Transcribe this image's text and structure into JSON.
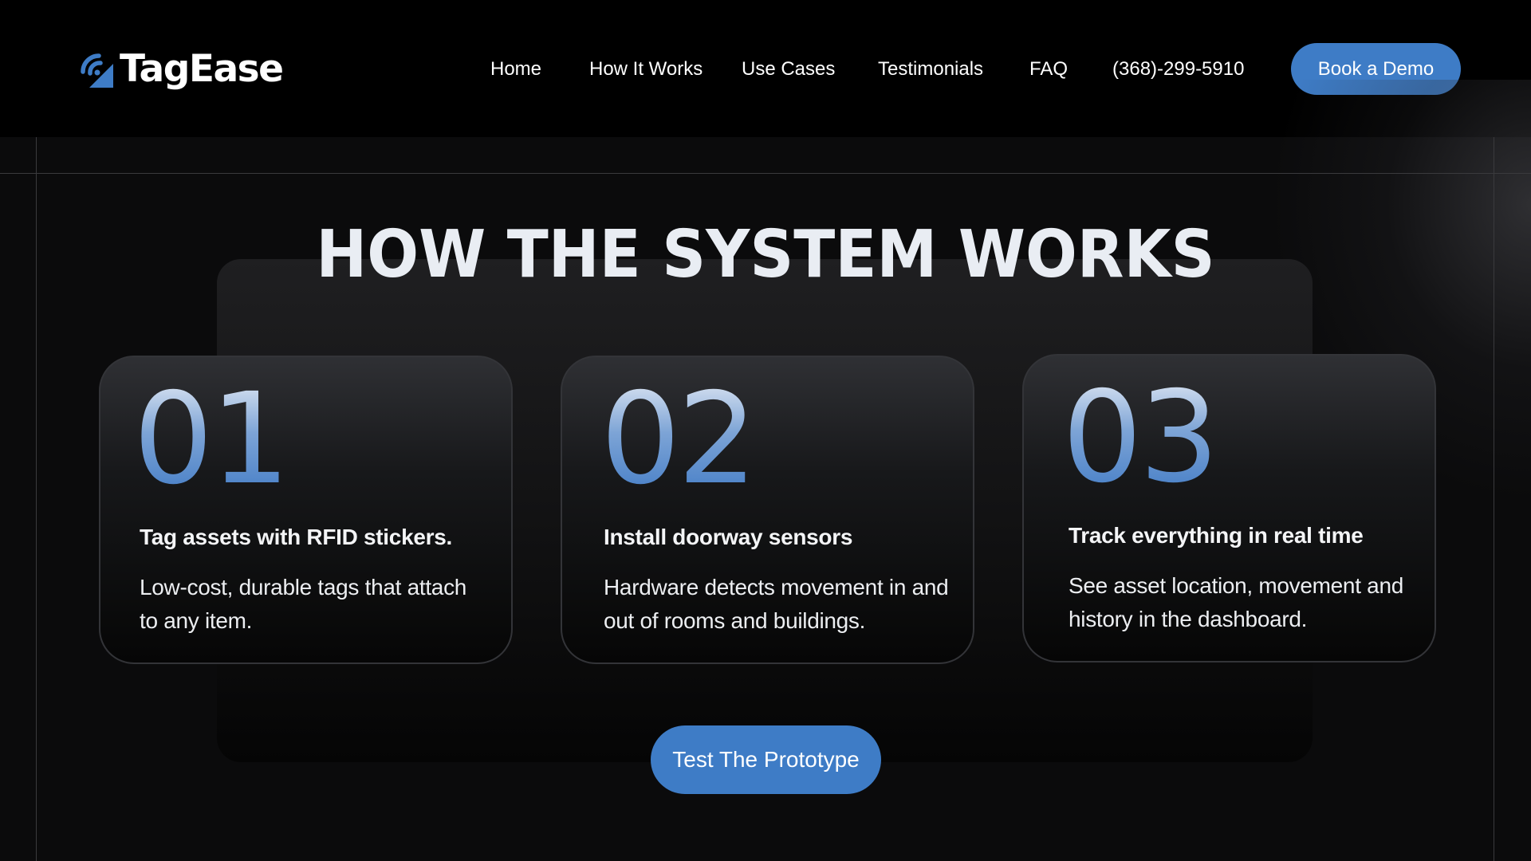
{
  "brand": {
    "name": "TagEase",
    "accent_color": "#3e7cc6",
    "logo_icon": "rfid-signal-tag-icon"
  },
  "nav": {
    "links": [
      {
        "label": "Home"
      },
      {
        "label": "How It Works"
      },
      {
        "label": "Use Cases"
      },
      {
        "label": "Testimonials"
      },
      {
        "label": "FAQ"
      }
    ],
    "phone": "(368)-299-5910",
    "cta_label": "Book a Demo"
  },
  "section": {
    "title": "HOW THE SYSTEM WORKS",
    "steps": [
      {
        "number": "01",
        "title": "Tag assets with RFID stickers.",
        "description": "Low-cost, durable tags that attach to any item."
      },
      {
        "number": "02",
        "title": "Install doorway sensors",
        "description": "Hardware detects movement in and out of rooms and buildings."
      },
      {
        "number": "03",
        "title": "Track everything in real time",
        "description": "See asset location, movement and history in the dashboard."
      }
    ],
    "cta_label": "Test The Prototype"
  }
}
